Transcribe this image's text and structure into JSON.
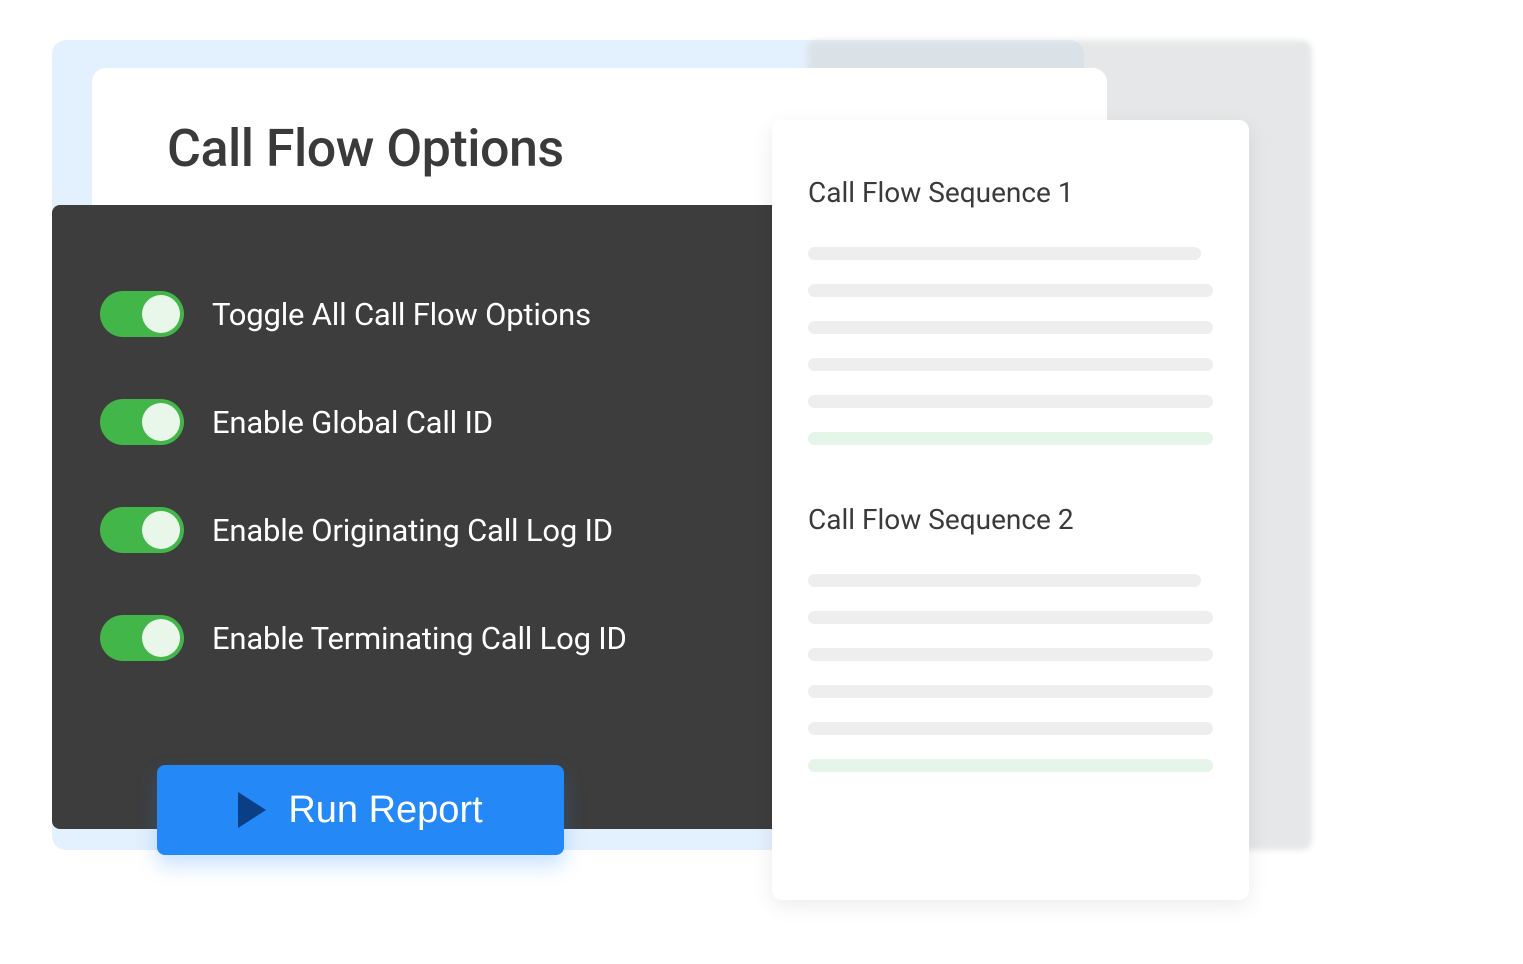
{
  "header": {
    "title": "Call Flow Options"
  },
  "toggles": [
    {
      "label": "Toggle All Call Flow Options",
      "on": true
    },
    {
      "label": "Enable Global Call ID",
      "on": true
    },
    {
      "label": "Enable Originating Call Log ID",
      "on": true
    },
    {
      "label": "Enable Terminating Call Log ID",
      "on": true
    }
  ],
  "run_button": {
    "label": "Run Report"
  },
  "sequences": [
    {
      "title": "Call Flow Sequence 1"
    },
    {
      "title": "Call Flow Sequence 2"
    }
  ],
  "colors": {
    "blue_bg": "#e3f0fd",
    "dark_panel": "#3d3d3d",
    "toggle_green": "#43b649",
    "button_blue": "#2488f6"
  }
}
